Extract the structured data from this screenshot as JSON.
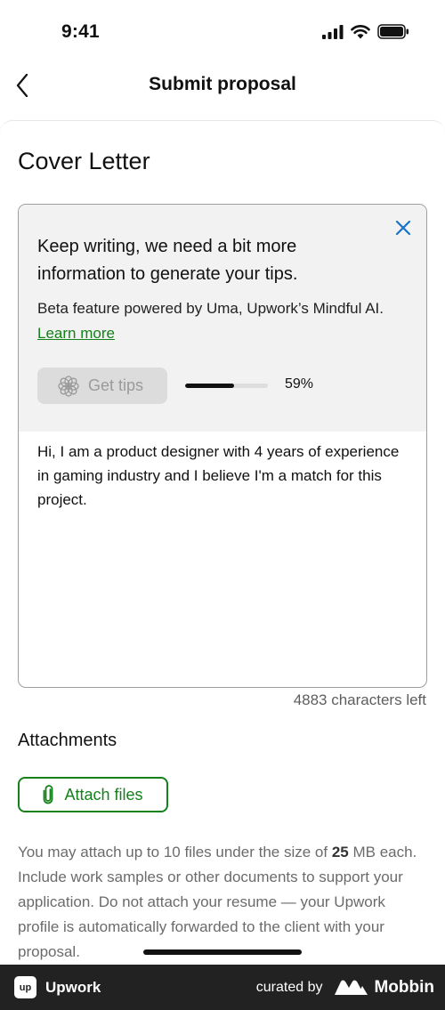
{
  "status_bar": {
    "time": "9:41"
  },
  "nav": {
    "title": "Submit proposal"
  },
  "cover_letter": {
    "title": "Cover Letter",
    "tips": {
      "heading": "Keep writing, we need a bit more information to generate your tips.",
      "description": "Beta feature powered by Uma, Upwork’s Mindful AI.",
      "learn_more": "Learn more",
      "button_label": "Get tips",
      "progress_percent": 59,
      "progress_label": "59%"
    },
    "text": "Hi, I am a product designer with 4 years of experience in gaming industry and I believe I'm a match for this project.",
    "chars_left": "4883 characters left"
  },
  "attachments": {
    "title": "Attachments",
    "button_label": "Attach files",
    "help_prefix": "You may attach up to 10 files under the size of ",
    "help_size": "25",
    "help_suffix": " MB each. Include work samples or other documents to support your application. Do not attach your resume — your Upwork profile is automatically forwarded to the client with your proposal."
  },
  "footer": {
    "brand_logo": "up",
    "brand": "Upwork",
    "curated_by": "curated by",
    "curator": "Mobbin"
  },
  "colors": {
    "accent_green": "#14811a",
    "link_blue": "#1a73c8",
    "footer_bg": "#222222"
  }
}
